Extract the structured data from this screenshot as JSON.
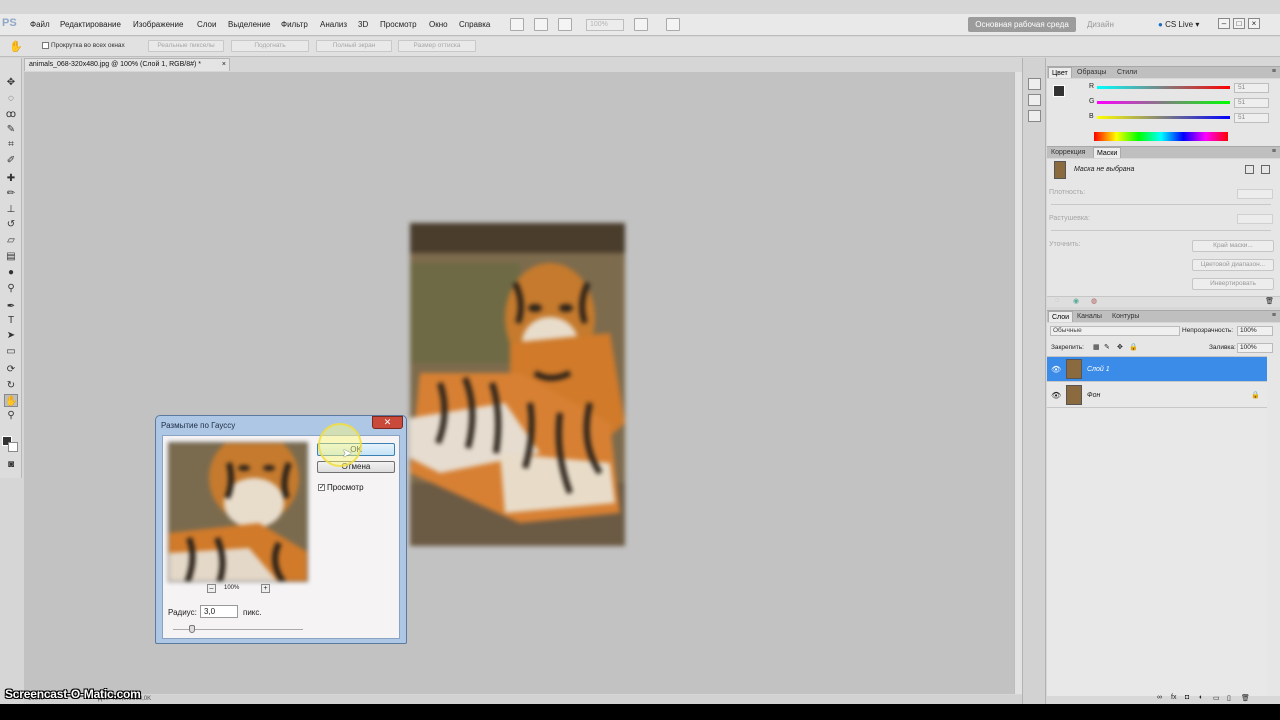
{
  "app": {
    "logo": "PS"
  },
  "menu": {
    "items": [
      "Файл",
      "Редактирование",
      "Изображение",
      "Слои",
      "Выделение",
      "Фильтр",
      "Анализ",
      "3D",
      "Просмотр",
      "Окно",
      "Справка"
    ],
    "zoom": "100%",
    "workspace": "Основная рабочая среда",
    "design": "Дизайн",
    "cslive": "CS Live"
  },
  "options": {
    "scroll_all": "Прокрутка во всех окнах",
    "buttons": [
      "Реальные пикселы",
      "Подогнать",
      "Полный экран",
      "Размер оттиска"
    ]
  },
  "document": {
    "tab_title": "animals_068-320x480.jpg @ 100% (Слой 1, RGB/8#) *",
    "status_zoom": "100%",
    "status_doc": "Док: 450,0K/900,0K"
  },
  "watermark": "Screencast-O-Matic.com",
  "dialog": {
    "title": "Размытие по Гауссу",
    "ok": "OK",
    "cancel": "Отмена",
    "preview_label": "Просмотр",
    "preview_checked": true,
    "zoom": "100%",
    "radius_label": "Радиус:",
    "radius_value": "3,0",
    "radius_unit": "пикс."
  },
  "color_panel": {
    "tabs": [
      "Цвет",
      "Образцы",
      "Стили"
    ],
    "channels": [
      {
        "label": "R",
        "value": "51"
      },
      {
        "label": "G",
        "value": "51"
      },
      {
        "label": "B",
        "value": "51"
      }
    ],
    "channel_colors": [
      "#e02020",
      "#20c020",
      "#2060e0"
    ]
  },
  "masks_panel": {
    "tabs": [
      "Коррекция",
      "Маски"
    ],
    "no_mask": "Маска не выбрана",
    "density": "Плотность:",
    "feather": "Растушевка:",
    "refine": "Уточнить:",
    "btn_edge": "Край маски...",
    "btn_color_range": "Цветовой диапазон...",
    "btn_invert": "Инвертировать"
  },
  "layers_panel": {
    "tabs": [
      "Слои",
      "Каналы",
      "Контуры"
    ],
    "blend_mode": "Обычные",
    "opacity_label": "Непрозрачность:",
    "opacity_value": "100%",
    "lock_label": "Закрепить:",
    "fill_label": "Заливка:",
    "fill_value": "100%",
    "layers": [
      {
        "name": "Слой 1",
        "selected": true
      },
      {
        "name": "Фон",
        "selected": false
      }
    ]
  },
  "accent": "#3b8be8"
}
